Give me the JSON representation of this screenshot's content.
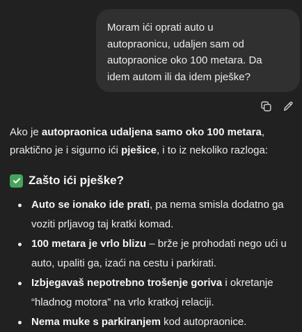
{
  "user_message": {
    "lines": [
      "Moram ići oprati auto u",
      "autopraonicu, udaljen sam od",
      "autopraonice oko 100 metara. Da",
      "idem autom ili da idem pješke?"
    ]
  },
  "message_actions": {
    "copy_icon": "copy-icon",
    "edit_icon": "pencil-icon"
  },
  "assistant": {
    "intro": {
      "l1_a": "Ako je ",
      "l1_b": "autopraonica udaljena samo oko 100 metara",
      "l1_c": ",",
      "l2_a": "praktično je i sigurno ići ",
      "l2_b": "pješice",
      "l2_c": ", i to iz nekoliko razloga:"
    },
    "section": {
      "icon": "check-mark-button-emoji",
      "icon_color": "#44a45c",
      "title": "Zašto ići pješke?"
    },
    "bullets": [
      {
        "bold": "Auto se ionako ide prati",
        "rest": ", pa nema smisla dodatno ga",
        "line2": "voziti prljavog taj kratki komad."
      },
      {
        "bold": "100 metara je vrlo blizu",
        "rest": " – brže je prohodati nego ući u",
        "line2": "auto, upaliti ga, izaći na cestu i parkirati."
      },
      {
        "bold": "Izbjegavaš nepotrebno trošenje goriva",
        "rest": " i okretanje",
        "line2": "“hladnog motora” na vrlo kratkoj relaciji."
      },
      {
        "bold": "Nema muke s parkiranjem",
        "rest": " kod autopraonice."
      }
    ]
  },
  "colors": {
    "background": "#212121",
    "user_bubble": "#303030",
    "text": "#ececec"
  }
}
